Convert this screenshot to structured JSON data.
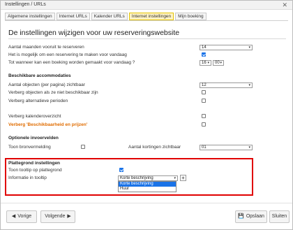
{
  "window": {
    "title": "Instellingen / URLs",
    "close_glyph": "✕"
  },
  "tabs": [
    {
      "label": "Algemene instellingen"
    },
    {
      "label": "Internet URLs"
    },
    {
      "label": "Kalender URLs"
    },
    {
      "label": "Internet instellingen",
      "active": true
    },
    {
      "label": "Mijn boeking"
    }
  ],
  "heading": "De instellingen wijzigen voor uw reserveringswebsite",
  "general": {
    "months_label": "Aantal maanden vooruit te reserveren",
    "months_value": "14",
    "same_day_label": "Het is mogelijk om een reservering te maken voor vandaag",
    "same_day_checked": true,
    "until_label": "Tot wanneer kan een boeking worden gemaakt voor vandaag ?",
    "until_hour": "16",
    "until_minute": "00"
  },
  "accommodations": {
    "title": "Beschikbare accommodaties",
    "per_page_label": "Aantal objecten (per pagina) zichtbaar",
    "per_page_value": "12",
    "hide_unavailable_label": "Verberg objecten als ze niet beschikbaar zijn",
    "hide_unavailable_checked": false,
    "hide_alternatives_label": "Verberg alternatieve perioden",
    "hide_alternatives_checked": false,
    "hide_calendar_label": "Verberg kalenderoverzicht",
    "hide_calendar_checked": false,
    "hide_price_label": "Verberg 'Beschikbaarheid en prijzen'",
    "hide_price_checked": false
  },
  "optional": {
    "title": "Optionele invoervelden",
    "show_source_label": "Toon bronvermelding",
    "show_source_checked": false,
    "discounts_label": "Aantal kortingen zichtbaar",
    "discounts_value": "01"
  },
  "map": {
    "title": "Plattegrond instellingen",
    "tooltip_label": "Toon tooltip op plattegrond",
    "tooltip_checked": true,
    "info_label": "Informatie in tooltip",
    "info_value": "Korte beschrijving",
    "add_glyph": "+",
    "options": [
      "Korte beschrijving",
      "Huur"
    ]
  },
  "footer": {
    "prev_label": "Vorige",
    "next_label": "Volgende",
    "save_label": "Opslaan",
    "close_label": "Sluiten",
    "prev_icon": "◀",
    "next_icon": "▶",
    "save_icon": "💾"
  },
  "colors": {
    "accent": "#1a73e8",
    "highlight_tab": "#fff3c4",
    "warning_text": "#e06c00",
    "callout_border": "#e00000"
  }
}
